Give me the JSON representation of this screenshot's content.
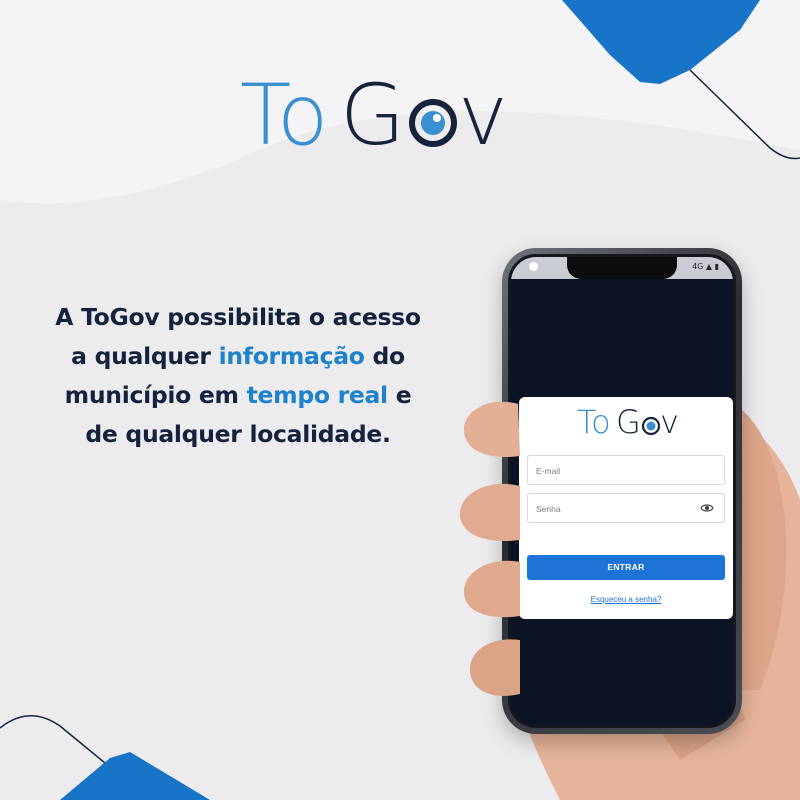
{
  "brand": {
    "logo_to": "To",
    "logo_g": "G",
    "logo_v": "v"
  },
  "headline": {
    "line1": "A ToGov possibilita o acesso",
    "line2_a": "a qualquer ",
    "line2_highlight": "informação",
    "line2_b": " do",
    "line3_a": "município em ",
    "line3_highlight": "tempo real",
    "line3_b": " e",
    "line4": "de qualquer localidade."
  },
  "phone": {
    "status_icons": "4G ▲ ▮",
    "login": {
      "logo_to": "To",
      "logo_g": "G",
      "logo_v": "v",
      "email_placeholder": "E-mail",
      "password_placeholder": "Senha",
      "submit_label": "ENTRAR",
      "forgot_label": "Esqueceu a senha?"
    }
  },
  "colors": {
    "accent_blue": "#1c82cc",
    "button_blue": "#1d73d6",
    "navy_text": "#14233d",
    "screen_bg": "#0b1424"
  }
}
